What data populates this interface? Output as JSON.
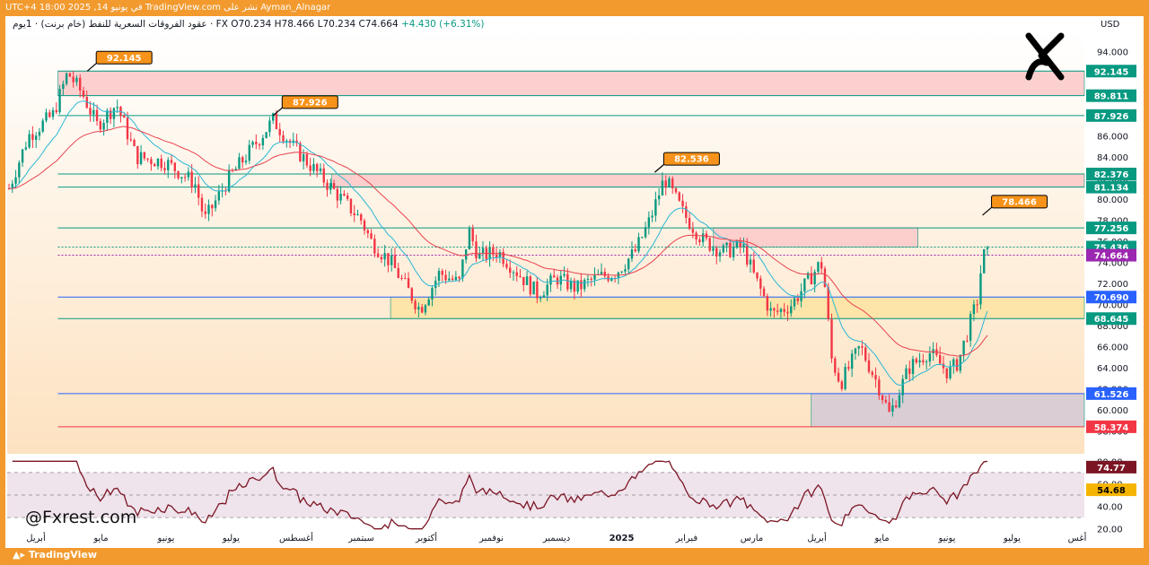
{
  "header": {
    "published_line": "Ayman_Alnagar نشر على TradingView.com في يونيو 14, 2025 18:00 UTC+4",
    "symbol_line": "عقود الفروقات السعرية للنفط (خام برنت) · 1يوم · FX",
    "ohlc": {
      "o": "O70.234",
      "h": "H78.466",
      "l": "L70.234",
      "c": "C74.664",
      "chg": "+4.430 (+6.31%)"
    }
  },
  "currency": "USD",
  "handle": "@Fxrest.com",
  "footer_brand": "TradingView",
  "colors": {
    "up": "#089981",
    "down": "#f23645",
    "frame": "#f29a2e",
    "ema_fast": "#2bb7d4",
    "ema_slow": "#e8424e",
    "rsi": "#7b1523"
  },
  "chart_data": {
    "type": "candlestick",
    "y_range": [
      57,
      96
    ],
    "y_ticks": [
      "94.000",
      "92.000",
      "90.000",
      "88.000",
      "86.000",
      "84.000",
      "82.000",
      "80.000",
      "78.000",
      "76.000",
      "74.000",
      "72.000",
      "70.000",
      "68.000",
      "66.000",
      "64.000",
      "62.000",
      "60.000",
      "58.000"
    ],
    "x_labels": [
      "أبريل",
      "مايو",
      "يونيو",
      "يوليو",
      "أغسطس",
      "سبتمبر",
      "أكتوبر",
      "نوفمبر",
      "ديسمبر",
      "2025",
      "فبراير",
      "مارس",
      "أبريل",
      "مايو",
      "يونيو",
      "يوليو",
      "أغس"
    ],
    "price_levels": [
      {
        "label": "92.145",
        "value": 92.145,
        "color": "#089981"
      },
      {
        "label": "89.811",
        "value": 89.811,
        "color": "#089981"
      },
      {
        "label": "87.926",
        "value": 87.926,
        "color": "#089981"
      },
      {
        "label": "82.376",
        "value": 82.376,
        "color": "#089981"
      },
      {
        "label": "81.134",
        "value": 81.134,
        "color": "#089981"
      },
      {
        "label": "77.256",
        "value": 77.256,
        "color": "#089981"
      },
      {
        "label": "75.436",
        "value": 75.436,
        "color": "#089981"
      },
      {
        "label": "74.664",
        "value": 74.664,
        "color": "#9c27b0"
      },
      {
        "label": "70.690",
        "value": 70.69,
        "color": "#2962ff"
      },
      {
        "label": "68.645",
        "value": 68.645,
        "color": "#089981"
      },
      {
        "label": "61.526",
        "value": 61.526,
        "color": "#2962ff"
      },
      {
        "label": "58.374",
        "value": 58.374,
        "color": "#f23645"
      }
    ],
    "callouts": [
      {
        "label": "92.145",
        "value": 92.145,
        "t": 0.08
      },
      {
        "label": "87.926",
        "value": 87.926,
        "t": 0.27
      },
      {
        "label": "82.536",
        "value": 82.536,
        "t": 0.66
      },
      {
        "label": "78.466",
        "value": 78.466,
        "t": 0.995
      }
    ],
    "zones": [
      {
        "from": 89.811,
        "to": 92.145,
        "t0": 0.05,
        "t1": 1.0,
        "color": "#fbc8c8"
      },
      {
        "from": 81.134,
        "to": 82.376,
        "t0": 0.33,
        "t1": 1.0,
        "color": "#fbc8c8"
      },
      {
        "from": 75.436,
        "to": 77.256,
        "t0": 0.72,
        "t1": 0.83,
        "color": "#fbc8c8"
      },
      {
        "from": 68.645,
        "to": 70.69,
        "t0": 0.39,
        "t1": 1.0,
        "color": "#fde3a0"
      },
      {
        "from": 58.374,
        "to": 61.526,
        "t0": 0.82,
        "t1": 1.0,
        "color": "#d3c9d6"
      }
    ],
    "series_path": [
      [
        0,
        81
      ],
      [
        0.02,
        86
      ],
      [
        0.045,
        88
      ],
      [
        0.06,
        92
      ],
      [
        0.075,
        90
      ],
      [
        0.09,
        87
      ],
      [
        0.11,
        89
      ],
      [
        0.13,
        84
      ],
      [
        0.16,
        83.5
      ],
      [
        0.19,
        81.5
      ],
      [
        0.2,
        78
      ],
      [
        0.225,
        82
      ],
      [
        0.25,
        85
      ],
      [
        0.27,
        87.5
      ],
      [
        0.29,
        85
      ],
      [
        0.31,
        83
      ],
      [
        0.33,
        81
      ],
      [
        0.36,
        78
      ],
      [
        0.37,
        76
      ],
      [
        0.39,
        74
      ],
      [
        0.4,
        72.5
      ],
      [
        0.42,
        69.5
      ],
      [
        0.44,
        73
      ],
      [
        0.46,
        72
      ],
      [
        0.47,
        77
      ],
      [
        0.48,
        74.5
      ],
      [
        0.5,
        75
      ],
      [
        0.52,
        73
      ],
      [
        0.54,
        71
      ],
      [
        0.56,
        72.5
      ],
      [
        0.58,
        71.5
      ],
      [
        0.6,
        72.5
      ],
      [
        0.62,
        73
      ],
      [
        0.64,
        75
      ],
      [
        0.655,
        78
      ],
      [
        0.67,
        82
      ],
      [
        0.69,
        78.5
      ],
      [
        0.71,
        76
      ],
      [
        0.73,
        75
      ],
      [
        0.75,
        75.5
      ],
      [
        0.76,
        73
      ],
      [
        0.78,
        69
      ],
      [
        0.8,
        70
      ],
      [
        0.83,
        74
      ],
      [
        0.835,
        71
      ],
      [
        0.84,
        65
      ],
      [
        0.85,
        62.5
      ],
      [
        0.87,
        66
      ],
      [
        0.89,
        62
      ],
      [
        0.9,
        59.5
      ],
      [
        0.92,
        64
      ],
      [
        0.94,
        65.5
      ],
      [
        0.96,
        63.5
      ],
      [
        0.97,
        64.5
      ],
      [
        0.98,
        67.5
      ],
      [
        0.99,
        70.5
      ],
      [
        0.995,
        74.664
      ]
    ],
    "rsi": {
      "y_ticks": [
        "80.00",
        "60.00",
        "40.00",
        "20.00"
      ],
      "levels": [
        {
          "label": "74.77",
          "value": 74.77,
          "color": "#7b1523"
        },
        {
          "label": "54.68",
          "value": 54.68,
          "color": "#f5b400"
        }
      ],
      "range": [
        15,
        85
      ]
    }
  }
}
